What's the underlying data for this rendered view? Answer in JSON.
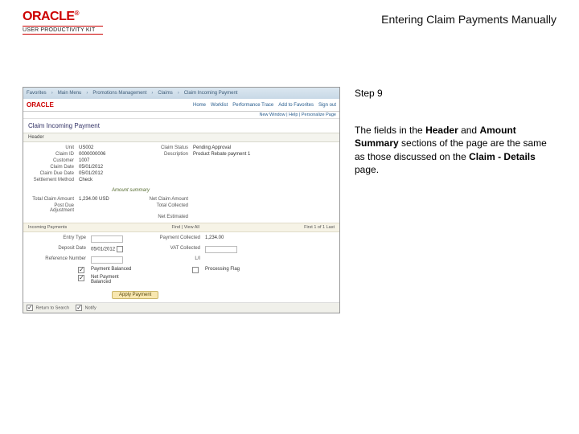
{
  "brand": {
    "name": "ORACLE",
    "reg": "®",
    "sub": "USER PRODUCTIVITY KIT"
  },
  "title": "Entering Claim Payments Manually",
  "step": "Step 9",
  "instruction": {
    "p1a": "The fields in the ",
    "p1b": "Header",
    "p1c": " and ",
    "p1d": "Amount Summary",
    "p1e": " sections of the page are the same as those discussed on the ",
    "p1f": "Claim - Details",
    "p1g": " page."
  },
  "ss": {
    "crumbs": [
      "Favorites",
      "Main Menu",
      "Promotions Management",
      "Claims",
      "Claim Incoming Payment"
    ],
    "brand": "ORACLE",
    "toplinks": [
      "Home",
      "Worklist",
      "Performance Trace",
      "Add to Favorites",
      "Sign out"
    ],
    "topright": "New Window | Help | Personalize Page",
    "pageTitle": "Claim Incoming Payment",
    "headerTab": "Header",
    "fields": {
      "unitLbl": "Unit",
      "unitVal": "US002",
      "claimIdLbl": "Claim ID",
      "claimIdVal": "0000000006",
      "statusLbl": "Claim Status",
      "statusVal": "Pending Approval",
      "descLbl": "Description",
      "descVal": "Product Rebate payment 1",
      "custLbl": "Customer",
      "custVal": "1007",
      "dateLbl": "Claim Date",
      "dateVal": "05/01/2012",
      "dueLbl": "Claim Due Date",
      "dueVal": "05/01/2012",
      "methLbl": "Settlement Method",
      "methVal": "Check"
    },
    "sectionLabel": "Amount summary",
    "amtFields": {
      "totalLbl": "Total Claim Amount",
      "totalVal": "1,234.00 USD",
      "netLbl": "Net Claim Amount",
      "postLbl": "Post Due Adjustment",
      "collLbl": "Total Collected",
      "estLbl": "Net Estimated"
    },
    "amountBar": {
      "left": "Incoming Payments",
      "mid": "Find | View All",
      "right": "First 1 of 1 Last"
    },
    "pay": {
      "entryLbl": "Entry Type",
      "depLbl": "Deposit Date",
      "depVal": "05/01/2012",
      "refLbl": "Reference Number",
      "balLbl": "Payment Balanced",
      "pbalLbl": "Net Payment Balanced",
      "amtLbl": "Payment Collected",
      "amtVal": "1,234.00",
      "vatLbl": "VAT Collected",
      "tipLbl": "L/I",
      "procLbl": "Processing Flag"
    },
    "btn": "Apply Payment",
    "tabs": {
      "ret": "Return to Search",
      "notify": "Notify"
    }
  }
}
